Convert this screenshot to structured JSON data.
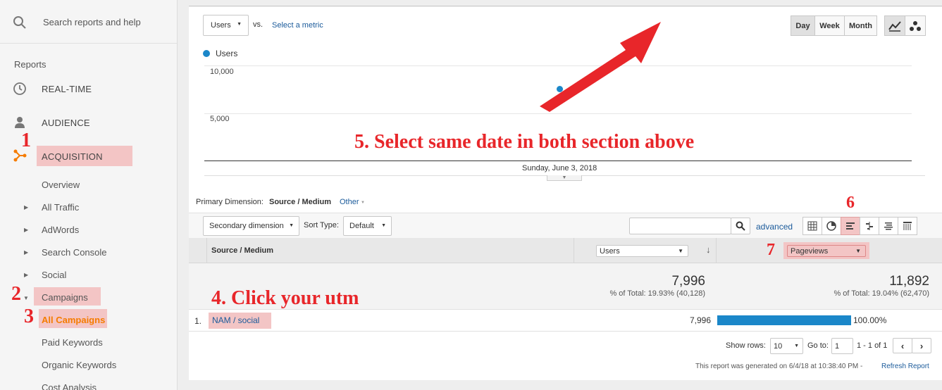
{
  "sidebar": {
    "search_placeholder": "Search reports and help",
    "reports_label": "Reports",
    "realtime": "REAL-TIME",
    "audience": "AUDIENCE",
    "acquisition": "ACQUISITION",
    "overview": "Overview",
    "all_traffic": "All Traffic",
    "adwords": "AdWords",
    "search_console": "Search Console",
    "social": "Social",
    "campaigns": "Campaigns",
    "all_campaigns": "All Campaigns",
    "paid_keywords": "Paid Keywords",
    "organic_keywords": "Organic Keywords",
    "cost_analysis": "Cost Analysis"
  },
  "chart": {
    "metric_select": "Users",
    "vs_label": "vs.",
    "select_metric_link": "Select a metric",
    "period_buttons": [
      "Day",
      "Week",
      "Month"
    ],
    "active_period": "Day"
  },
  "chart_data": {
    "type": "line",
    "series": [
      {
        "name": "Users",
        "x": [
          "Sunday, June 3, 2018"
        ],
        "values": [
          7996
        ]
      }
    ],
    "y_ticks": [
      "10,000",
      "5,000"
    ],
    "x_label": "Sunday, June 3, 2018",
    "ylim": [
      0,
      12500
    ],
    "accent_color": "#1b87c9"
  },
  "dimension": {
    "primary_label": "Primary Dimension:",
    "primary_value": "Source / Medium",
    "other_link": "Other",
    "secondary_dimension": "Secondary dimension",
    "sort_type_label": "Sort Type:",
    "sort_type_value": "Default",
    "advanced_link": "advanced"
  },
  "table": {
    "col_source": "Source / Medium",
    "col_users_select": "Users",
    "col_pageviews_select": "Pageviews",
    "total_users": "7,996",
    "total_users_pct": "% of Total: 19.93% (40,128)",
    "total_pageviews": "11,892",
    "total_pageviews_pct": "% of Total: 19.04% (62,470)",
    "rows": [
      {
        "index": "1.",
        "source": "NAM / social",
        "users": "7,996",
        "pageviews_pct": "100.00%",
        "bar_fraction": 1.0
      }
    ]
  },
  "pager": {
    "show_rows_label": "Show rows:",
    "show_rows_value": "10",
    "goto_label": "Go to:",
    "goto_value": "1",
    "range": "1 - 1 of 1"
  },
  "footer": {
    "generated": "This report was generated on 6/4/18 at 10:38:40 PM -",
    "refresh_link": "Refresh Report"
  },
  "annotations": {
    "n1": "1",
    "n2": "2",
    "n3": "3",
    "n6": "6",
    "n7": "7",
    "step4": "4. Click your utm",
    "step5": "5. Select same date in both section above"
  },
  "colors": {
    "annotation_red": "#e8262a",
    "highlight_pink": "#f3c5c5",
    "link_blue": "#1a5a9a",
    "acquisition_orange": "#f57c00",
    "bar_blue": "#1b87c9"
  }
}
